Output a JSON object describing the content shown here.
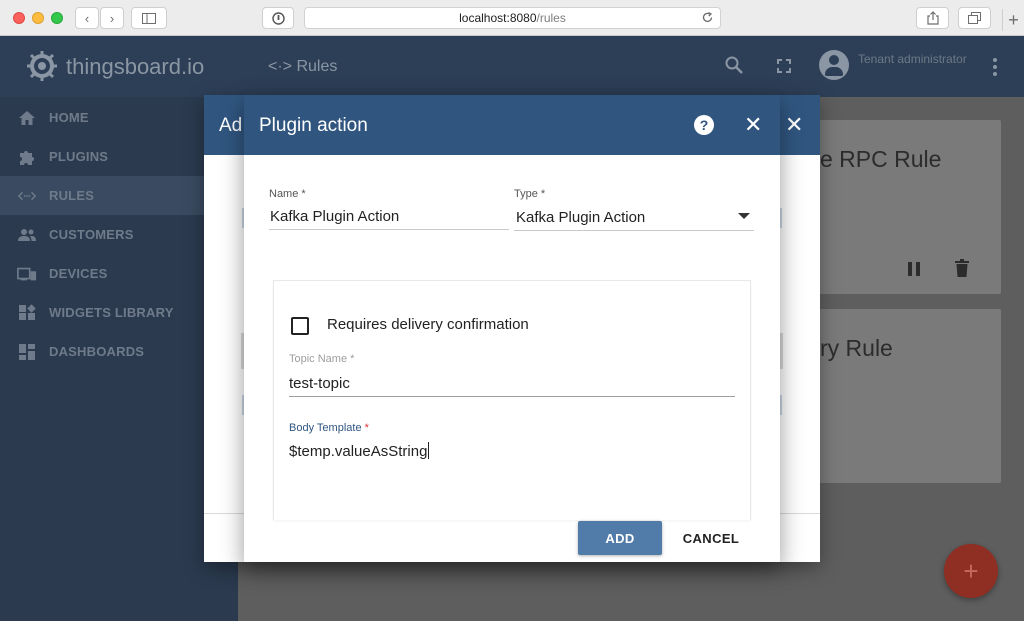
{
  "browser": {
    "url_host": "localhost:8080",
    "url_path": "/rules",
    "new_tab": "+"
  },
  "header": {
    "logo_text": "thingsboard.io",
    "page_title": "<·> Rules",
    "user_role": "Tenant administrator"
  },
  "sidebar": {
    "items": [
      {
        "label": "HOME",
        "icon": "home-icon"
      },
      {
        "label": "PLUGINS",
        "icon": "puzzle-icon"
      },
      {
        "label": "RULES",
        "icon": "code-arrows-icon"
      },
      {
        "label": "CUSTOMERS",
        "icon": "people-icon"
      },
      {
        "label": "DEVICES",
        "icon": "devices-icon"
      },
      {
        "label": "WIDGETS LIBRARY",
        "icon": "widgets-icon"
      },
      {
        "label": "DASHBOARDS",
        "icon": "dashboard-icon"
      }
    ],
    "active": "RULES"
  },
  "main": {
    "cards": [
      {
        "title": "e RPC Rule"
      },
      {
        "title": "ry Rule"
      }
    ],
    "fab_label": "+"
  },
  "back_dialog": {
    "title": "Ad"
  },
  "dialog": {
    "title": "Plugin action",
    "name_label": "Name",
    "name_value": "Kafka Plugin Action",
    "type_label": "Type",
    "type_value": "Kafka Plugin Action",
    "required_mark": "*",
    "checkbox_label": "Requires delivery confirmation",
    "checkbox_checked": false,
    "topic_label": "Topic Name",
    "topic_value": "test-topic",
    "body_label": "Body Template",
    "body_value": "$temp.valueAsString",
    "add_label": "ADD",
    "cancel_label": "CANCEL"
  },
  "colors": {
    "header": "#2d3f57",
    "sidebar": "#2b3a4f",
    "dialog_header": "#305680",
    "add_button": "#517ba9",
    "fab": "#8f2e22"
  }
}
